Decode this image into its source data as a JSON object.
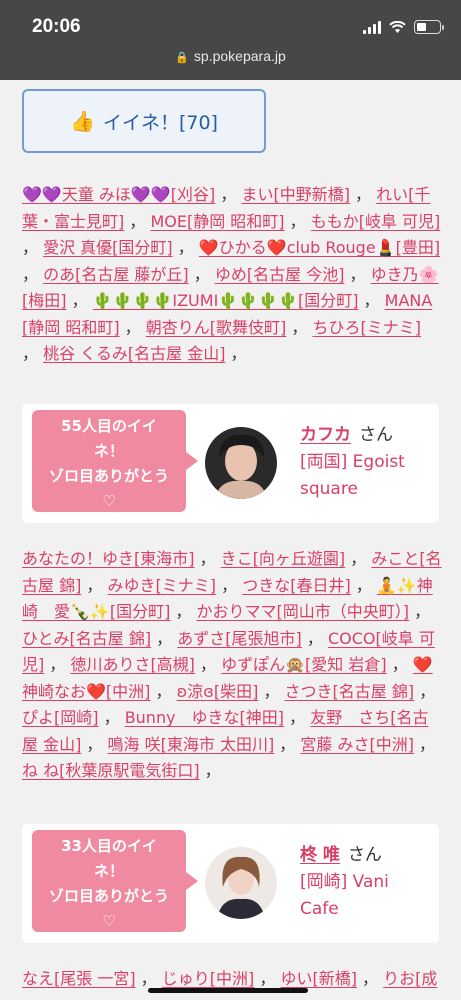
{
  "status": {
    "time": "20:06",
    "url": "sp.pokepara.jp"
  },
  "like_button": {
    "label": "イイネ！[70]",
    "icon": "thumbs-up-icon"
  },
  "names_block_1": [
    "💜💜天童 みほ💜💜[刈谷]",
    "まい[中野新橋]",
    "れい[千葉・富士見町]",
    "MOE[静岡 昭和町]",
    "ももか[岐阜 可児]",
    "愛沢 真優[国分町]",
    "❤️ひかる❤️club Rouge💄[豊田]",
    "のあ[名古屋 藤が丘]",
    "ゆめ[名古屋 今池]",
    "ゆき乃🌸[梅田]",
    "🌵🌵🌵🌵IZUMI🌵🌵🌵🌵[国分町]",
    "MANA[静岡 昭和町]",
    "朝杏りん[歌舞伎町]",
    "ちひろ[ミナミ]",
    "桃谷 くるみ[名古屋 金山]"
  ],
  "card_1": {
    "bubble": [
      "55人目のイイ",
      "ネ！",
      "ゾロ目ありがとう",
      "♡"
    ],
    "girl_name": "カフカ",
    "san": "さん",
    "shop": "[両国] Egoist square"
  },
  "names_block_2": [
    "あなたの！ゆき[東海市]",
    "きこ[向ヶ丘遊園]",
    "みこと[名古屋 錦]",
    "みゆき[ミナミ]",
    "つきな[春日井]",
    "🧘✨神崎　愛🍾✨[国分町]",
    "かおりママ[岡山市（中央町）]",
    "ひとみ[名古屋 錦]",
    "あずさ[尾張旭市]",
    "COCO[岐阜 可児]",
    "徳川ありさ[高槻]",
    "ゆずぽん🙊[愛知 岩倉]",
    "❤️神崎なお❤️[中洲]",
    "ʚ涼ɞ[柴田]",
    "さつき[名古屋 錦]",
    "ぴよ[岡崎]",
    "Bunny　ゆきな[神田]",
    "友野　さち[名古屋 金山]",
    "鳴海 咲[東海市 太田川]",
    "宮藤 みさ[中洲]",
    "ね ね[秋葉原駅電気街口]"
  ],
  "card_2": {
    "bubble": [
      "33人目のイイ",
      "ネ！",
      "ゾロ目ありがとう",
      "♡"
    ],
    "girl_name": "柊 唯",
    "san": "さん",
    "shop": "[岡崎] Vani Cafe"
  },
  "names_block_3": [
    "なえ[尾張 一宮]",
    "じゅり[中洲]",
    "ゆい[新橋]",
    "りお[成田]"
  ]
}
